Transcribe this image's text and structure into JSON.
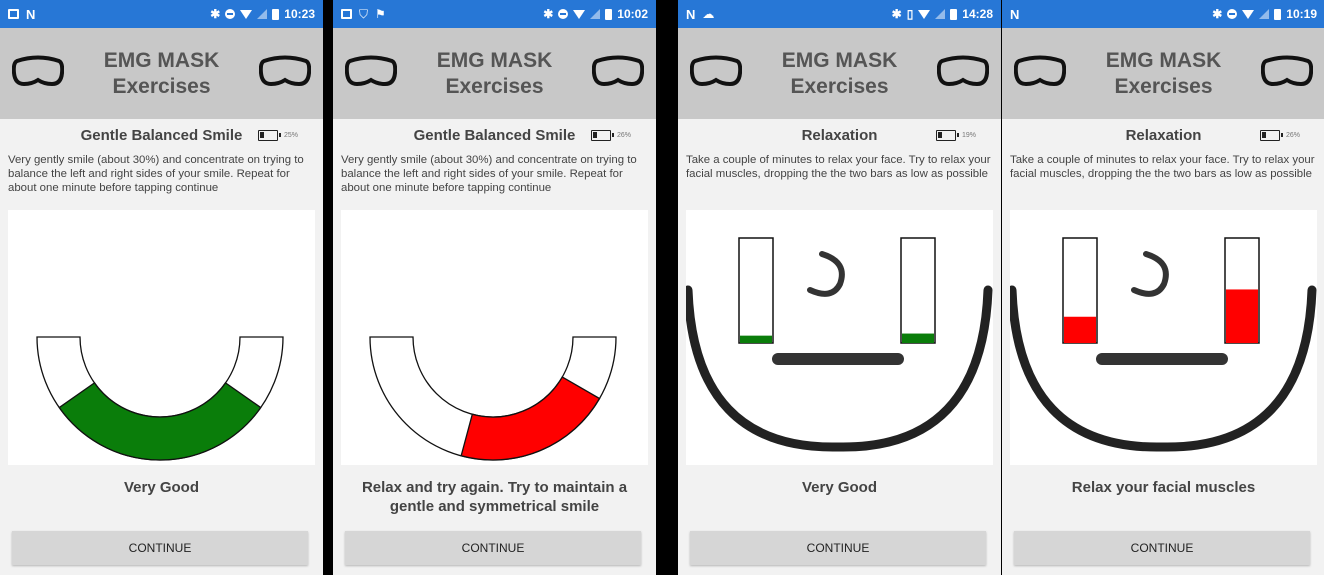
{
  "colors": {
    "status_bar": "#2777d6",
    "header": "#c8c8c8",
    "good": "#0a7d0a",
    "bad": "#ff0000"
  },
  "screens": [
    {
      "status": {
        "time": "10:23",
        "left_icons": [
          "image-icon",
          "n-icon"
        ]
      },
      "header": {
        "line1": "EMG MASK",
        "line2": "Exercises"
      },
      "exercise": {
        "title": "Gentle Balanced Smile",
        "battery": "25%",
        "instructions": "Very gently smile (about 30%) and concentrate on trying to balance the left and right sides of your smile. Repeat for about one minute before tapping continue"
      },
      "visual": {
        "type": "smile-arc",
        "fill_start_deg": 35,
        "fill_end_deg": 145,
        "fill_color": "#0a7d0a"
      },
      "feedback": "Very Good",
      "continue_label": "CONTINUE"
    },
    {
      "status": {
        "time": "10:02",
        "left_icons": [
          "image-icon",
          "shield-icon",
          "flag-icon"
        ]
      },
      "header": {
        "line1": "EMG MASK",
        "line2": "Exercises"
      },
      "exercise": {
        "title": "Gentle Balanced Smile",
        "battery": "26%",
        "instructions": "Very gently smile (about 30%) and concentrate on trying to balance the left and right sides of your smile. Repeat for about one minute before tapping continue"
      },
      "visual": {
        "type": "smile-arc",
        "fill_start_deg": 30,
        "fill_end_deg": 105,
        "fill_color": "#ff0000"
      },
      "feedback": "Relax and try again. Try to maintain a gentle and symmetrical smile",
      "continue_label": "CONTINUE"
    },
    {
      "status": {
        "time": "14:28",
        "left_icons": [
          "n-icon",
          "cloud-icon"
        ]
      },
      "header": {
        "line1": "EMG MASK",
        "line2": "Exercises"
      },
      "exercise": {
        "title": "Relaxation",
        "battery": "19%",
        "instructions": "Take a couple of minutes to relax your face. Try to relax your facial muscles, dropping the the two bars as low as possible"
      },
      "visual": {
        "type": "face-bars",
        "left_level": 0.07,
        "right_level": 0.09,
        "left_color": "#0a7d0a",
        "right_color": "#0a7d0a"
      },
      "feedback": "Very Good",
      "continue_label": "CONTINUE"
    },
    {
      "status": {
        "time": "10:19",
        "left_icons": [
          "n-icon"
        ]
      },
      "header": {
        "line1": "EMG MASK",
        "line2": "Exercises"
      },
      "exercise": {
        "title": "Relaxation",
        "battery": "26%",
        "instructions": "Take a couple of minutes to relax your face. Try to relax your facial muscles, dropping the the two bars as low as possible"
      },
      "visual": {
        "type": "face-bars",
        "left_level": 0.25,
        "right_level": 0.51,
        "left_color": "#ff0000",
        "right_color": "#ff0000"
      },
      "feedback": "Relax your facial muscles",
      "continue_label": "CONTINUE"
    }
  ]
}
